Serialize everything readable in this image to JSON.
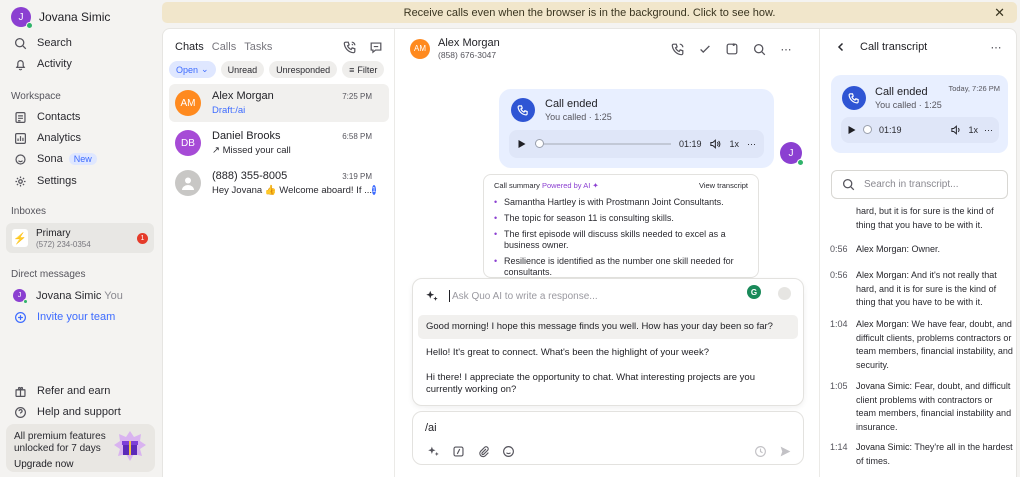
{
  "user": {
    "initial": "J",
    "name": "Jovana Simic"
  },
  "nav": {
    "search": "Search",
    "activity": "Activity"
  },
  "workspace": {
    "label": "Workspace",
    "contacts": "Contacts",
    "analytics": "Analytics",
    "sona": "Sona",
    "sona_badge": "New",
    "settings": "Settings"
  },
  "inboxes": {
    "label": "Inboxes",
    "primary_name": "Primary",
    "primary_number": "(572) 234-0354",
    "primary_count": "1"
  },
  "direct": {
    "label": "Direct messages",
    "self_name": "Jovana Simic",
    "self_suffix": "You",
    "invite": "Invite your team"
  },
  "footer": {
    "refer": "Refer and earn",
    "help": "Help and support",
    "promo_text": "All premium features unlocked for 7 days",
    "promo_cta": "Upgrade now"
  },
  "banner": {
    "text": "Receive calls even when the browser is in the background. Click to see how."
  },
  "chatlist": {
    "tabs": [
      "Chats",
      "Calls",
      "Tasks"
    ],
    "filters": {
      "open": "Open",
      "unread": "Unread",
      "unresponded": "Unresponded",
      "filter": "Filter"
    },
    "items": [
      {
        "initials": "AM",
        "color": "#ff8a1f",
        "name": "Alex Morgan",
        "time": "7:25 PM",
        "prefix": "Draft:",
        "preview": " /ai"
      },
      {
        "initials": "DB",
        "color": "#a64bd6",
        "name": "Daniel Brooks",
        "time": "6:58 PM",
        "preview": "↗ Missed your call"
      },
      {
        "initials": "",
        "color": "#c8c7c5",
        "name": "(888) 355-8005",
        "time": "3:19 PM",
        "preview": "Hey Jovana 👍 Welcome aboard! If ...",
        "unread": "1"
      }
    ]
  },
  "conversation": {
    "contact_initials": "AM",
    "contact_name": "Alex Morgan",
    "contact_number": "(858) 676-3047",
    "call": {
      "title": "Call ended",
      "sub": "You called · 1:25",
      "duration": "01:19",
      "speed": "1x"
    },
    "avatar_initial": "J",
    "summary": {
      "label": "Call summary",
      "powered": "Powered by AI ✦",
      "view": "View transcript",
      "points": [
        "Samantha Hartley is with Prostmann Joint Consultants.",
        "The topic for season 11 is consulting skills.",
        "The first episode will discuss skills needed to excel as a business owner.",
        "Resilience is identified as the number one skill needed for consultants."
      ]
    },
    "ai": {
      "placeholder": "Ask Quo AI to write a response...",
      "suggestions": [
        "Good morning! I hope this message finds you well. How has your day been so far?",
        "Hello! It's great to connect. What's been the highlight of your week?",
        "Hi there! I appreciate the opportunity to chat. What interesting projects are you currently working on?"
      ]
    },
    "composer_value": "/ai"
  },
  "transcript": {
    "title": "Call transcript",
    "call_title": "Call ended",
    "call_sub": "You called · 1:25",
    "call_when": "Today, 7:26 PM",
    "duration": "01:19",
    "speed": "1x",
    "search_placeholder": "Search in transcript...",
    "lines": [
      {
        "ts": "",
        "speaker": "",
        "text": "hard, but it is for sure is the kind of thing that you have to be with it."
      },
      {
        "ts": "0:56",
        "speaker": "Alex Morgan:",
        "text": " Owner."
      },
      {
        "ts": "0:56",
        "speaker": "Alex Morgan:",
        "text": " And it's not really that hard, and it is for sure is the kind of thing that you have to be with it."
      },
      {
        "ts": "1:04",
        "speaker": "Alex Morgan:",
        "text": " We have fear, doubt, and difficult clients, problems contractors or team members, financial instability, and security."
      },
      {
        "ts": "1:05",
        "speaker": "Jovana Simic:",
        "text": " Fear, doubt, and difficult client problems with contractors or team members, financial instability and insurance."
      },
      {
        "ts": "1:14",
        "speaker": "Jovana Simic:",
        "text": " They're all in the hardest of times."
      }
    ]
  }
}
